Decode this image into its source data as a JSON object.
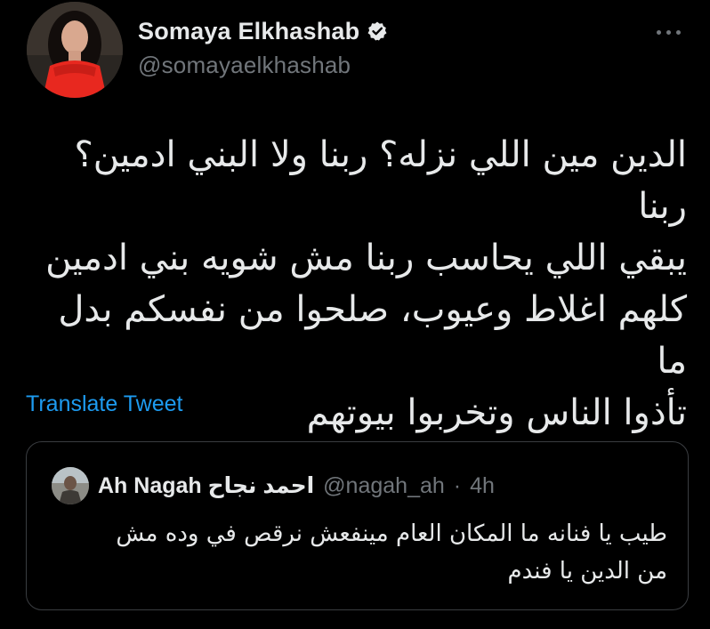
{
  "author": {
    "display_name": "Somaya Elkhashab",
    "handle": "@somayaelkhashab",
    "verified": true
  },
  "tweet": {
    "text": "الدين مين اللي نزله؟ ربنا ولا البني ادمين؟ ربنا\nيبقي اللي يحاسب ربنا مش شويه بني ادمين\nكلهم اغلاط وعيوب، صلحوا من نفسكم بدل ما\nتأذوا الناس وتخربوا بيوتهم",
    "translate_label": "Translate Tweet"
  },
  "quoted_tweet": {
    "display_name": "Ah Nagah احمد نجاح",
    "handle": "@nagah_ah",
    "separator": "·",
    "time": "4h",
    "text": "طيب يا فنانه ما المكان العام مينفعش نرقص في وده مش\nمن الدين يا فندم"
  },
  "icons": {
    "verified": "verified-badge-icon",
    "more": "more-dots-icon"
  },
  "colors": {
    "background": "#000000",
    "text_primary": "#e7e9ea",
    "text_secondary": "#71767b",
    "link": "#1d9bf0",
    "border": "#3a3d41"
  }
}
